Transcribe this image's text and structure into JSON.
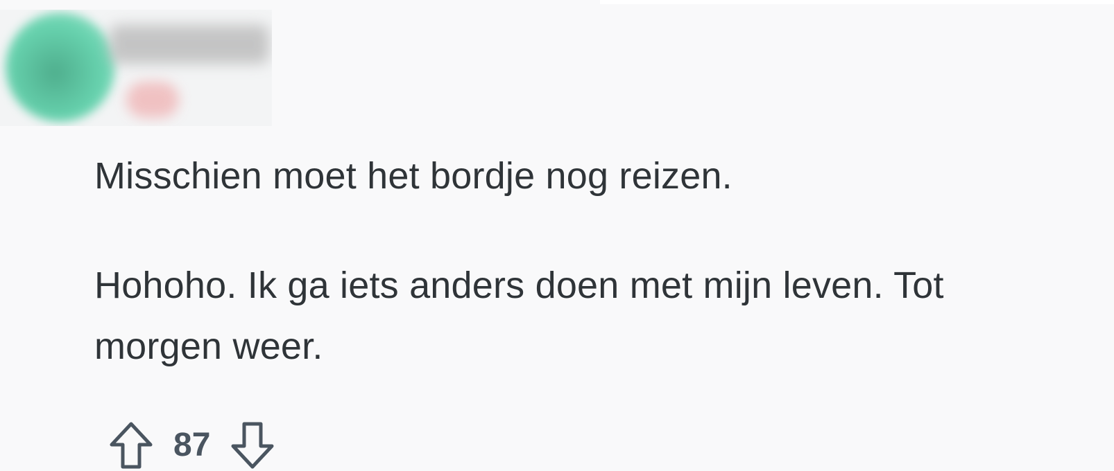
{
  "comment": {
    "paragraph_1": "Misschien moet het bordje nog reizen.",
    "paragraph_2_line_1": "Hohoho. Ik ga iets anders doen met mijn leven. Tot",
    "paragraph_2_line_2": "morgen weer."
  },
  "votes": {
    "score": "87",
    "upvote_icon": "arrow-up-outline",
    "downvote_icon": "arrow-down-outline"
  },
  "colors": {
    "background": "#f9f9fa",
    "text": "#2f3438",
    "vote_text": "#4a5560",
    "avatar_green": "#67d2ae",
    "flair_pink": "#f0b9ba"
  }
}
